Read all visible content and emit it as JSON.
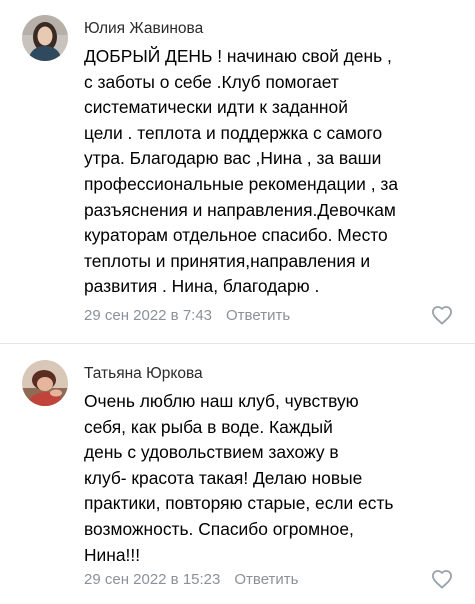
{
  "comments": [
    {
      "author": "Юлия Жавинова",
      "lines": [
        "ДОБРЫЙ ДЕНЬ ! начинаю свой день ,",
        "с заботы о себе .Клуб помогает",
        "систематически идти к заданной",
        "цели . теплота и поддержка с самого",
        "утра. Благодарю вас ,Нина , за ваши",
        "профессиональные рекомендации , за",
        "разъяснения и направления.Девочкам",
        "кураторам отдельное спасибо. Место",
        "теплоты и принятия,направления и",
        "развития . Нина, благодарю ."
      ],
      "date": "29 сен 2022 в 7:43",
      "reply_label": "Ответить",
      "avatar_icon": "user-avatar-photo",
      "like_icon": "heart-outline-icon"
    },
    {
      "author": "Татьяна Юркова",
      "lines": [
        "Очень люблю наш клуб, чувствую",
        "себя, как рыба в воде. Каждый",
        "день с удовольствием захожу в",
        "клуб- красота такая! Делаю новые",
        "практики, повторяю старые, если есть",
        "возможность. Спасибо огромное,",
        "Нина!!!"
      ],
      "date": "29 сен 2022 в 15:23",
      "reply_label": "Ответить",
      "avatar_icon": "user-avatar-photo",
      "like_icon": "heart-outline-icon"
    }
  ],
  "colors": {
    "meta_text": "#8a9199",
    "divider": "#e3e5e8",
    "like_icon": "#9aa2ab"
  }
}
